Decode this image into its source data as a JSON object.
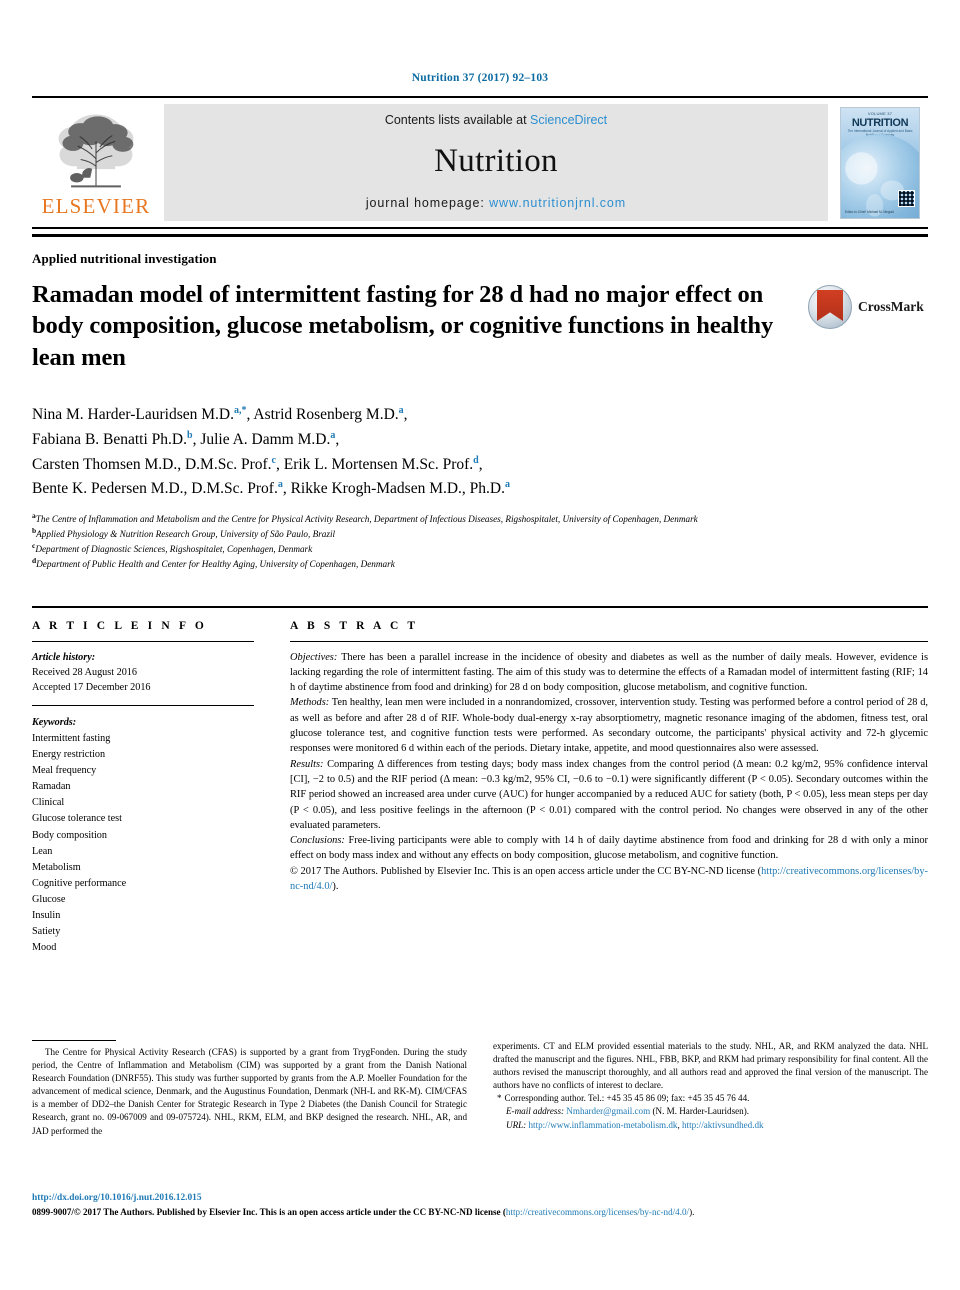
{
  "running_head": "Nutrition 37 (2017) 92–103",
  "masthead": {
    "contents_prefix": "Contents lists available at ",
    "sciencedirect": "ScienceDirect",
    "journal_name": "Nutrition",
    "homepage_prefix": "journal homepage: ",
    "homepage_url": "www.nutritionjrnl.com",
    "publisher_logo_text": "ELSEVIER",
    "cover": {
      "volume_line": "VOLUME 37",
      "title": "NUTRITION",
      "subtitle": "The International Journal of Applied and Basic Nutritional Sciences",
      "footer": "Editor-in-Chief: Michael M. Meguid"
    }
  },
  "article": {
    "section_label": "Applied nutritional investigation",
    "title": "Ramadan model of intermittent fasting for 28 d had no major effect on body composition, glucose metabolism, or cognitive functions in healthy lean men",
    "crossmark_label": "CrossMark",
    "authors_lines": [
      "Nina M. Harder-Lauridsen M.D. a,*, Astrid Rosenberg M.D. a,",
      "Fabiana B. Benatti Ph.D. b, Julie A. Damm M.D. a,",
      "Carsten Thomsen M.D., D.M.Sc. Prof. c, Erik L. Mortensen M.Sc. Prof. d,",
      "Bente K. Pedersen M.D., D.M.Sc. Prof. a, Rikke Krogh-Madsen M.D., Ph.D. a"
    ],
    "affiliations": [
      {
        "marker": "a",
        "text": "The Centre of Inflammation and Metabolism and the Centre for Physical Activity Research, Department of Infectious Diseases, Rigshospitalet, University of Copenhagen, Denmark"
      },
      {
        "marker": "b",
        "text": "Applied Physiology & Nutrition Research Group, University of São Paulo, Brazil"
      },
      {
        "marker": "c",
        "text": "Department of Diagnostic Sciences, Rigshospitalet, Copenhagen, Denmark"
      },
      {
        "marker": "d",
        "text": "Department of Public Health and Center for Healthy Aging, University of Copenhagen, Denmark"
      }
    ]
  },
  "article_info": {
    "heading": "A R T I C L E  I N F O",
    "history_label": "Article history:",
    "history_lines": [
      "Received 28 August 2016",
      "Accepted 17 December 2016"
    ],
    "keywords_label": "Keywords:",
    "keywords": [
      "Intermittent fasting",
      "Energy restriction",
      "Meal frequency",
      "Ramadan",
      "Clinical",
      "Glucose tolerance test",
      "Body composition",
      "Lean",
      "Metabolism",
      "Cognitive performance",
      "Glucose",
      "Insulin",
      "Satiety",
      "Mood"
    ]
  },
  "abstract": {
    "heading": "A B S T R A C T",
    "objectives_label": "Objectives:",
    "objectives_text": " There has been a parallel increase in the incidence of obesity and diabetes as well as the number of daily meals. However, evidence is lacking regarding the role of intermittent fasting. The aim of this study was to determine the effects of a Ramadan model of intermittent fasting (RIF; 14 h of daytime abstinence from food and drinking) for 28 d on body composition, glucose metabolism, and cognitive function.",
    "methods_label": "Methods:",
    "methods_text": " Ten healthy, lean men were included in a nonrandomized, crossover, intervention study. Testing was performed before a control period of 28 d, as well as before and after 28 d of RIF. Whole-body dual-energy x-ray absorptiometry, magnetic resonance imaging of the abdomen, fitness test, oral glucose tolerance test, and cognitive function tests were performed. As secondary outcome, the participants' physical activity and 72-h glycemic responses were monitored 6 d within each of the periods. Dietary intake, appetite, and mood questionnaires also were assessed.",
    "results_label": "Results:",
    "results_text": " Comparing Δ differences from testing days; body mass index changes from the control period (Δ mean: 0.2 kg/m2, 95% confidence interval [CI], −2 to 0.5) and the RIF period (Δ mean: −0.3 kg/m2, 95% CI, −0.6 to −0.1) were significantly different (P < 0.05). Secondary outcomes within the RIF period showed an increased area under curve (AUC) for hunger accompanied by a reduced AUC for satiety (both, P < 0.05), less mean steps per day (P < 0.05), and less positive feelings in the afternoon (P < 0.01) compared with the control period. No changes were observed in any of the other evaluated parameters.",
    "conclusions_label": "Conclusions:",
    "conclusions_text": " Free-living participants were able to comply with 14 h of daily daytime abstinence from food and drinking for 28 d with only a minor effect on body mass index and without any effects on body composition, glucose metabolism, and cognitive function.",
    "copyright_text": "© 2017 The Authors. Published by Elsevier Inc. This is an open access article under the CC BY-NC-ND license (",
    "license_url": "http://creativecommons.org/licenses/by-nc-nd/4.0/",
    "copyright_tail": ")."
  },
  "notes": {
    "funding_text": "The Centre for Physical Activity Research (CFAS) is supported by a grant from TrygFonden. During the study period, the Centre of Inflammation and Metabolism (CIM) was supported by a grant from the Danish National Research Foundation (DNRF55). This study was further supported by grants from the A.P. Moeller Foundation for the advancement of medical science, Denmark, and the Augustinus Foundation, Denmark (NH-L and RK-M). CIM/CFAS is a member of DD2–the Danish Center for Strategic Research in Type 2 Diabetes (the Danish Council for Strategic Research, grant no. 09-067009 and 09-075724). NHL, RKM, ELM, and BKP designed the research. NHL, AR, and JAD performed the",
    "contributions_text": "experiments. CT and ELM provided essential materials to the study. NHL, AR, and RKM analyzed the data. NHL drafted the manuscript and the figures. NHL, FBB, BKP, and RKM had primary responsibility for final content. All the authors revised the manuscript thoroughly, and all authors read and approved the final version of the manuscript. The authors have no conflicts of interest to declare.",
    "corresponding_marker": "*",
    "corresponding_text": "Corresponding author. Tel.: +45 35 45 86 09; fax: +45 35 45 76 44.",
    "email_label": "E-mail address:",
    "email_value": "Nmharder@gmail.com",
    "email_tail": "(N. M. Harder-Lauridsen).",
    "url_label": "URL:",
    "url_1": "http://www.inflammation-metabolism.dk",
    "url_2": "http://aktivsundhed.dk"
  },
  "footer": {
    "doi": "http://dx.doi.org/10.1016/j.nut.2016.12.015",
    "issn_line_prefix": "0899-9007/© 2017 The Authors. Published by Elsevier Inc. This is an open access article under the CC BY-NC-ND license (",
    "issn_license_url": "http://creativecommons.org/licenses/by-nc-nd/4.0/",
    "issn_line_tail": ")."
  },
  "colors": {
    "link_blue": "#1f7ab5",
    "elsevier_orange": "#e87722",
    "sciencedirect_blue": "#2d8fd0"
  }
}
